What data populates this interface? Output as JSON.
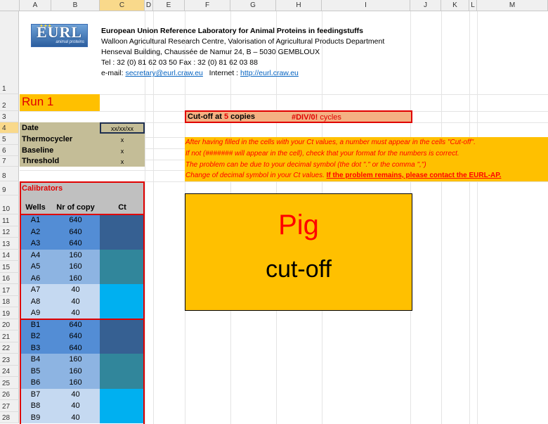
{
  "columns": [
    "A",
    "B",
    "C",
    "D",
    "E",
    "F",
    "G",
    "H",
    "I",
    "J",
    "K",
    "L",
    "M"
  ],
  "rows": [
    "1",
    "2",
    "3",
    "4",
    "5",
    "6",
    "7",
    "8",
    "9",
    "10",
    "11",
    "12",
    "13",
    "14",
    "15",
    "16",
    "17",
    "18",
    "19",
    "20",
    "21",
    "22",
    "23",
    "24",
    "25",
    "26",
    "27",
    "28"
  ],
  "logo": {
    "text": "EURL",
    "subtext": "animal proteins"
  },
  "header": {
    "line1": "European Union Reference Laboratory for Animal Proteins in feedingstuffs",
    "line2": "Walloon Agricultural Research Centre, Valorisation of Agricultural Products Department",
    "line3": "Henseval Building, Chaussée de Namur 24,  B – 5030  GEMBLOUX",
    "line4": "Tel : 32 (0) 81 62 03 50    Fax : 32 (0) 81 62 03 88",
    "email_prefix": "e-mail: ",
    "email": "secretary@eurl.craw.eu",
    "internet_prefix": "Internet : ",
    "internet": "http://eurl.craw.eu"
  },
  "run_title": "Run 1",
  "settings": [
    {
      "label": "Date",
      "value": "xx/xx/xx"
    },
    {
      "label": "Thermocycler",
      "value": "x"
    },
    {
      "label": "Baseline",
      "value": "x"
    },
    {
      "label": "Threshold",
      "value": "x"
    }
  ],
  "calibrators": {
    "title": "Calibrators",
    "headers": [
      "Wells",
      "Nr of copy",
      "Ct"
    ],
    "rows": [
      {
        "well": "A1",
        "copies": "640"
      },
      {
        "well": "A2",
        "copies": "640"
      },
      {
        "well": "A3",
        "copies": "640"
      },
      {
        "well": "A4",
        "copies": "160"
      },
      {
        "well": "A5",
        "copies": "160"
      },
      {
        "well": "A6",
        "copies": "160"
      },
      {
        "well": "A7",
        "copies": "40"
      },
      {
        "well": "A8",
        "copies": "40"
      },
      {
        "well": "A9",
        "copies": "40"
      },
      {
        "well": "B1",
        "copies": "640"
      },
      {
        "well": "B2",
        "copies": "640"
      },
      {
        "well": "B3",
        "copies": "640"
      },
      {
        "well": "B4",
        "copies": "160"
      },
      {
        "well": "B5",
        "copies": "160"
      },
      {
        "well": "B6",
        "copies": "160"
      },
      {
        "well": "B7",
        "copies": "40"
      },
      {
        "well": "B8",
        "copies": "40"
      },
      {
        "well": "B9",
        "copies": "40"
      }
    ]
  },
  "cutoff": {
    "prefix": "Cut-off at ",
    "copies_value": "5",
    "copies_suffix": " copies",
    "result": "#DIV/0!",
    "result_suffix": " cycles"
  },
  "instructions": {
    "line1": "After having filled in the cells with your Ct values, a number must appear in the cells \"Cut-off\".",
    "line2": "If not (####### will appear in the cell), check that your format for the numbers is correct.",
    "line3": "The problem can be due to your decimal symbol (the dot \".\" or the comma \",\")",
    "line4_prefix": "Change of decimal symbol in your Ct values.  ",
    "line4_bold": "If the problem remains, please contact the EURL-AP."
  },
  "species_box": {
    "species": "Pig",
    "caption": "cut-off"
  },
  "colors": {
    "orange": "#ffc000",
    "tan": "#c4bd97",
    "gray": "#c0c0c0",
    "red": "#e00000",
    "blue640": "#538dd5",
    "blue160": "#8db4e2",
    "blue40": "#c5d9f1",
    "ct640": "#366092",
    "ct160": "#31869b",
    "ct40": "#00b0f0",
    "salmon": "#f4b183"
  }
}
